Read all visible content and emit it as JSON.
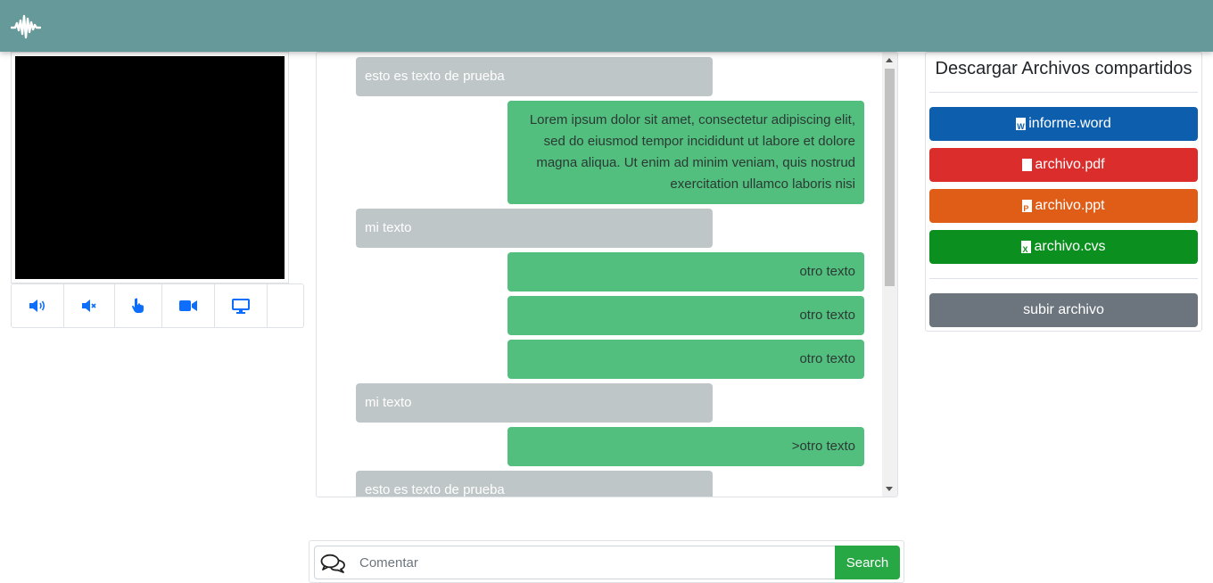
{
  "header": {
    "logo_icon": "audiomack-waveform-icon",
    "background_color": "#669999"
  },
  "video": {
    "screen_color": "#000000"
  },
  "controls": [
    {
      "icon": "volume-up-icon"
    },
    {
      "icon": "volume-mute-icon"
    },
    {
      "icon": "hand-pointer-icon"
    },
    {
      "icon": "video-camera-icon"
    },
    {
      "icon": "desktop-icon"
    },
    {
      "icon": ""
    }
  ],
  "chat": {
    "messages": [
      {
        "side": "them",
        "text": "esto es texto de prueba"
      },
      {
        "side": "me",
        "text": "Lorem ipsum dolor sit amet, consectetur adipiscing elit, sed do eiusmod tempor incididunt ut labore et dolore magna aliqua. Ut enim ad minim veniam, quis nostrud exercitation ullamco laboris nisi"
      },
      {
        "side": "them",
        "text": "mi texto"
      },
      {
        "side": "me",
        "text": "otro texto"
      },
      {
        "side": "me",
        "text": "otro texto"
      },
      {
        "side": "me",
        "text": "otro texto"
      },
      {
        "side": "them",
        "text": "mi texto"
      },
      {
        "side": "me",
        "text": ">otro texto"
      },
      {
        "side": "them",
        "text": "esto es texto de prueba"
      }
    ]
  },
  "files": {
    "title": "Descargar Archivos compartidos",
    "items": [
      {
        "label": "informe.word",
        "icon": "file-word-icon",
        "badge": "W",
        "color": "#0d5fad"
      },
      {
        "label": "archivo.pdf",
        "icon": "file-pdf-icon",
        "badge": "",
        "color": "#dc2d2d"
      },
      {
        "label": "archivo.ppt",
        "icon": "file-powerpoint-icon",
        "badge": "P",
        "color": "#e05d17"
      },
      {
        "label": "archivo.cvs",
        "icon": "file-excel-icon",
        "badge": "X",
        "color": "#0b8f1e"
      }
    ],
    "upload_label": "subir archivo",
    "upload_color": "#6c757d"
  },
  "comment": {
    "icon": "comments-icon",
    "placeholder": "Comentar",
    "value": "",
    "button_label": "Search"
  }
}
